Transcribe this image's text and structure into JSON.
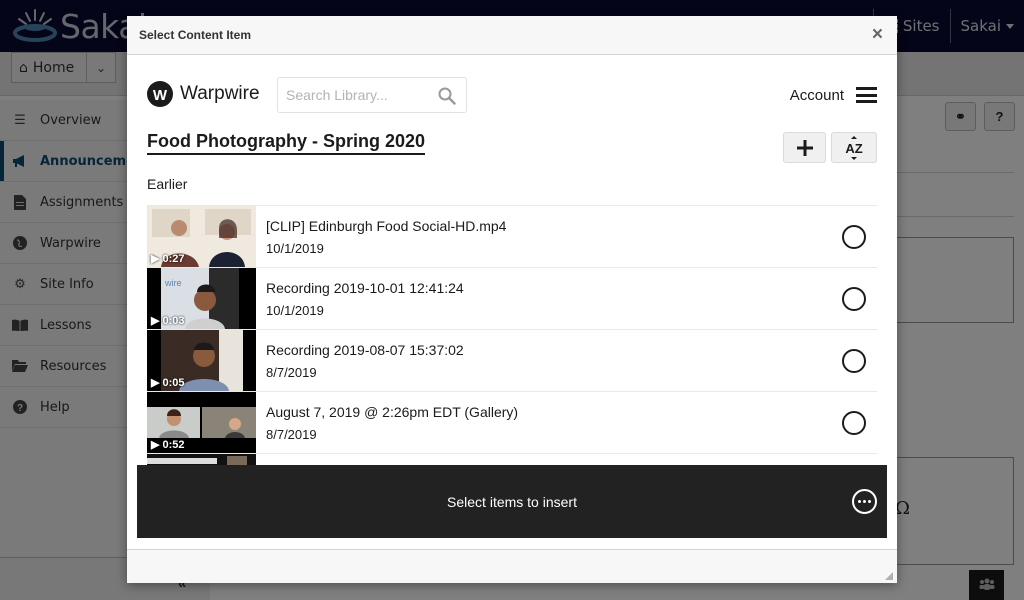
{
  "sakai": {
    "logo_text": "Sakai",
    "sites_label": "Sites",
    "user_label": "Sakai",
    "home_label": "Home",
    "sidebar": [
      {
        "label": "Overview",
        "icon": "list-icon",
        "glyph": "☰",
        "active": false
      },
      {
        "label": "Announcements",
        "icon": "megaphone-icon",
        "glyph": "📢",
        "active": true
      },
      {
        "label": "Assignments",
        "icon": "document-icon",
        "glyph": "🗎",
        "active": false
      },
      {
        "label": "Warpwire",
        "icon": "globe-icon",
        "glyph": "●",
        "active": false
      },
      {
        "label": "Site Info",
        "icon": "gear-icon",
        "glyph": "⚙",
        "active": false
      },
      {
        "label": "Lessons",
        "icon": "book-icon",
        "glyph": "📖",
        "active": false
      },
      {
        "label": "Resources",
        "icon": "folder-icon",
        "glyph": "📂",
        "active": false
      },
      {
        "label": "Help",
        "icon": "question-circle-icon",
        "glyph": "?",
        "active": false
      }
    ],
    "link_button": "⚭",
    "help_button": "?",
    "omega": "Ω",
    "collapse": "«"
  },
  "modal": {
    "title": "Select Content Item",
    "close": "×"
  },
  "warpwire": {
    "brand": "Warpwire",
    "brand_initial": "W",
    "search_placeholder": "Search Library...",
    "search_value": "",
    "account_label": "Account",
    "library_title": "Food Photography - Spring 2020",
    "add_label": "+",
    "sort_label": "AZ",
    "section_label": "Earlier",
    "items": [
      {
        "title": "[CLIP] Edinburgh Food Social-HD.mp4",
        "date": "10/1/2019",
        "duration": "▶ 0:27",
        "selected": false
      },
      {
        "title": "Recording 2019-10-01 12:41:24",
        "date": "10/1/2019",
        "duration": "▶ 0:03",
        "selected": false
      },
      {
        "title": "Recording 2019-08-07 15:37:02",
        "date": "8/7/2019",
        "duration": "▶ 0:05",
        "selected": false
      },
      {
        "title": "August 7, 2019 @ 2:26pm EDT (Gallery)",
        "date": "8/7/2019",
        "duration": "▶ 0:52",
        "selected": false
      }
    ],
    "insert_bar_label": "Select items to insert"
  }
}
